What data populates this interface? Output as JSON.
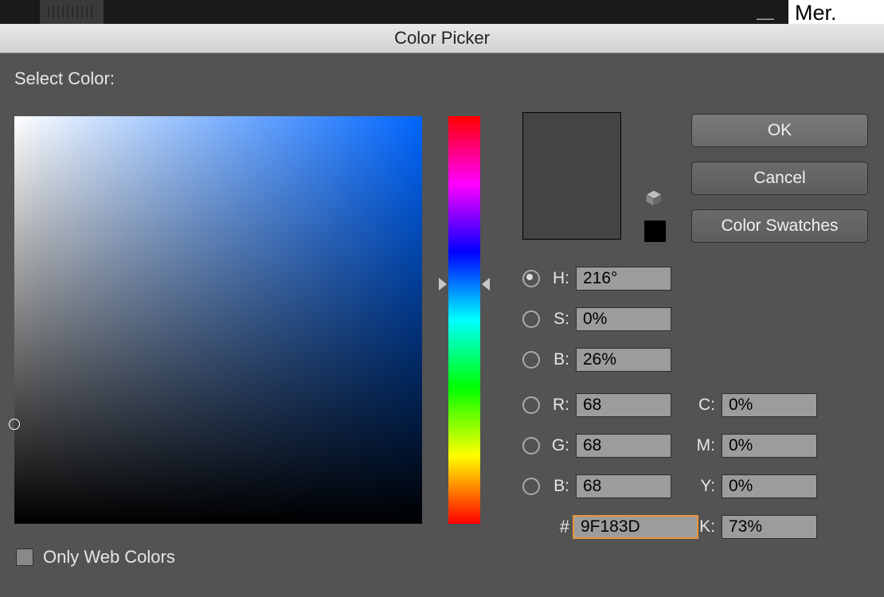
{
  "background": {
    "corner_text": "Mer.",
    "minimize_glyph": "—"
  },
  "dialog": {
    "title": "Color Picker",
    "heading": "Select Color:",
    "buttons": {
      "ok": "OK",
      "cancel": "Cancel",
      "swatches": "Color Swatches"
    },
    "hsb": {
      "h_label": "H:",
      "h_value": "216°",
      "s_label": "S:",
      "s_value": "0%",
      "b_label": "B:",
      "b_value": "26%",
      "selected_radio": "H"
    },
    "rgb": {
      "r_label": "R:",
      "r_value": "68",
      "g_label": "G:",
      "g_value": "68",
      "b_label": "B:",
      "b_value": "68"
    },
    "cmyk": {
      "c_label": "C:",
      "c_value": "0%",
      "m_label": "M:",
      "m_value": "0%",
      "y_label": "Y:",
      "y_value": "0%",
      "k_label": "K:",
      "k_value": "73%"
    },
    "hex": {
      "hash": "#",
      "value": "9F183D"
    },
    "web_only": {
      "label": "Only Web Colors",
      "checked": false
    },
    "colors": {
      "field_hue_css": "hsl(216,100%,50%)",
      "new_swatch": "#444444",
      "old_swatch": "#000000"
    }
  }
}
